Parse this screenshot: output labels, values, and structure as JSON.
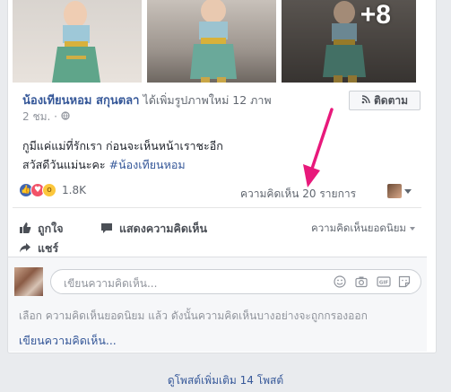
{
  "post": {
    "photos": {
      "more_count": "+8"
    },
    "author_name": "น้องเทียนหอม สกุนตลา",
    "action_text": "ได้เพิ่มรูปภาพใหม่ 12 ภาพ",
    "time": "2 ชม.",
    "follow_label": "ติดตาม",
    "text_line1": "กูมีแค่แม่ที่รักเรา ก่อนจะเห็นหน้าเราชะอีก",
    "text_line2": "สวัสดีวันแม่นะคะ",
    "hashtag": "#น้องเทียนหอม",
    "reaction_count": "1.8K",
    "comment_count": "ความคิดเห็น 20 รายการ"
  },
  "actions": {
    "like_label": "ถูกใจ",
    "comment_label": "แสดงความคิดเห็น",
    "share_label": "แชร์",
    "sort_label": "ความคิดเห็นยอดนิยม"
  },
  "comment_box": {
    "placeholder": "เขียนความคิดเห็น..."
  },
  "notes": {
    "top_comments_note": "เลือก ความคิดเห็นยอดนิยม แล้ว ดังนั้นความคิดเห็นบางอย่างจะถูกกรองออก",
    "write_comment_link": "เขียนความคิดเห็น..."
  },
  "footer": {
    "more_posts": "ดูโพสต์เพิ่มเติม 14 โพสต์"
  },
  "colors": {
    "link": "#365899",
    "annotation_arrow": "#e8197b"
  }
}
